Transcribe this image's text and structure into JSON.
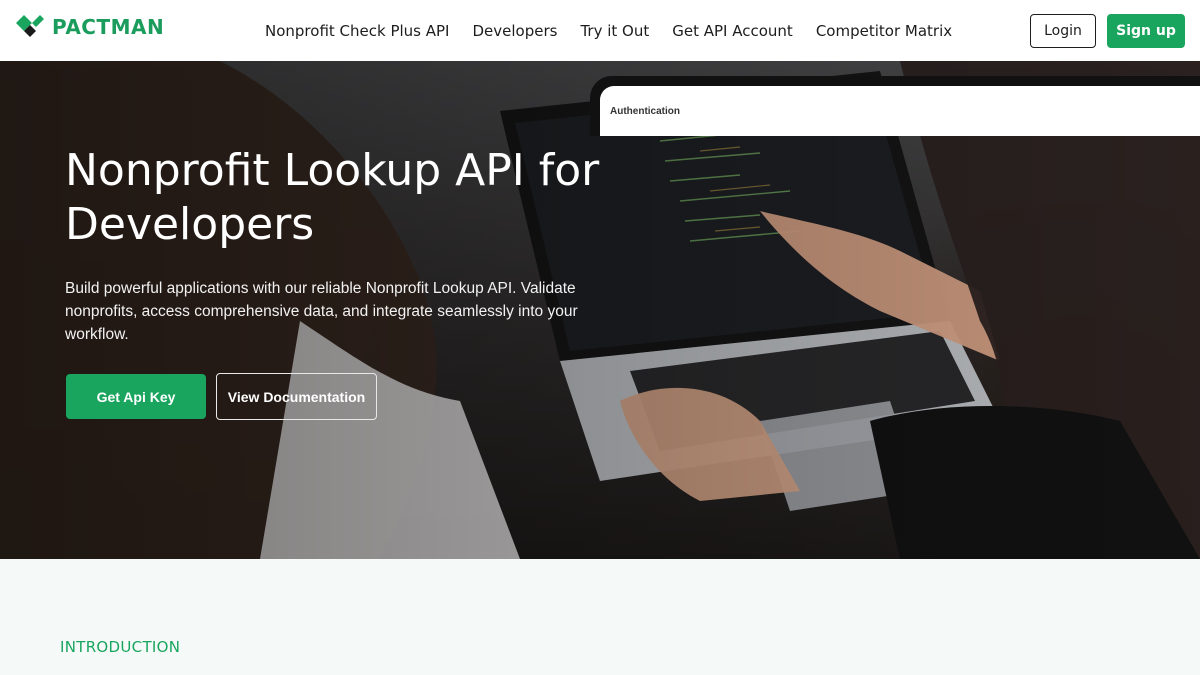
{
  "brand": {
    "name": "PACTMAN",
    "color": "#1aa55f"
  },
  "nav": {
    "items": [
      {
        "label": "Nonprofit Check Plus API"
      },
      {
        "label": "Developers"
      },
      {
        "label": "Try it Out"
      },
      {
        "label": "Get API Account"
      },
      {
        "label": "Competitor Matrix"
      }
    ],
    "login_label": "Login",
    "signup_label": "Sign up"
  },
  "hero": {
    "title": "Nonprofit Lookup API for Developers",
    "description": "Build powerful applications with our reliable Nonprofit Lookup API. Validate nonprofits, access comprehensive data, and integrate seamlessly into your workflow.",
    "primary_button": "Get Api Key",
    "secondary_button": "View Documentation"
  },
  "intro": {
    "label": "INTRODUCTION",
    "device_label": "Authentication"
  }
}
